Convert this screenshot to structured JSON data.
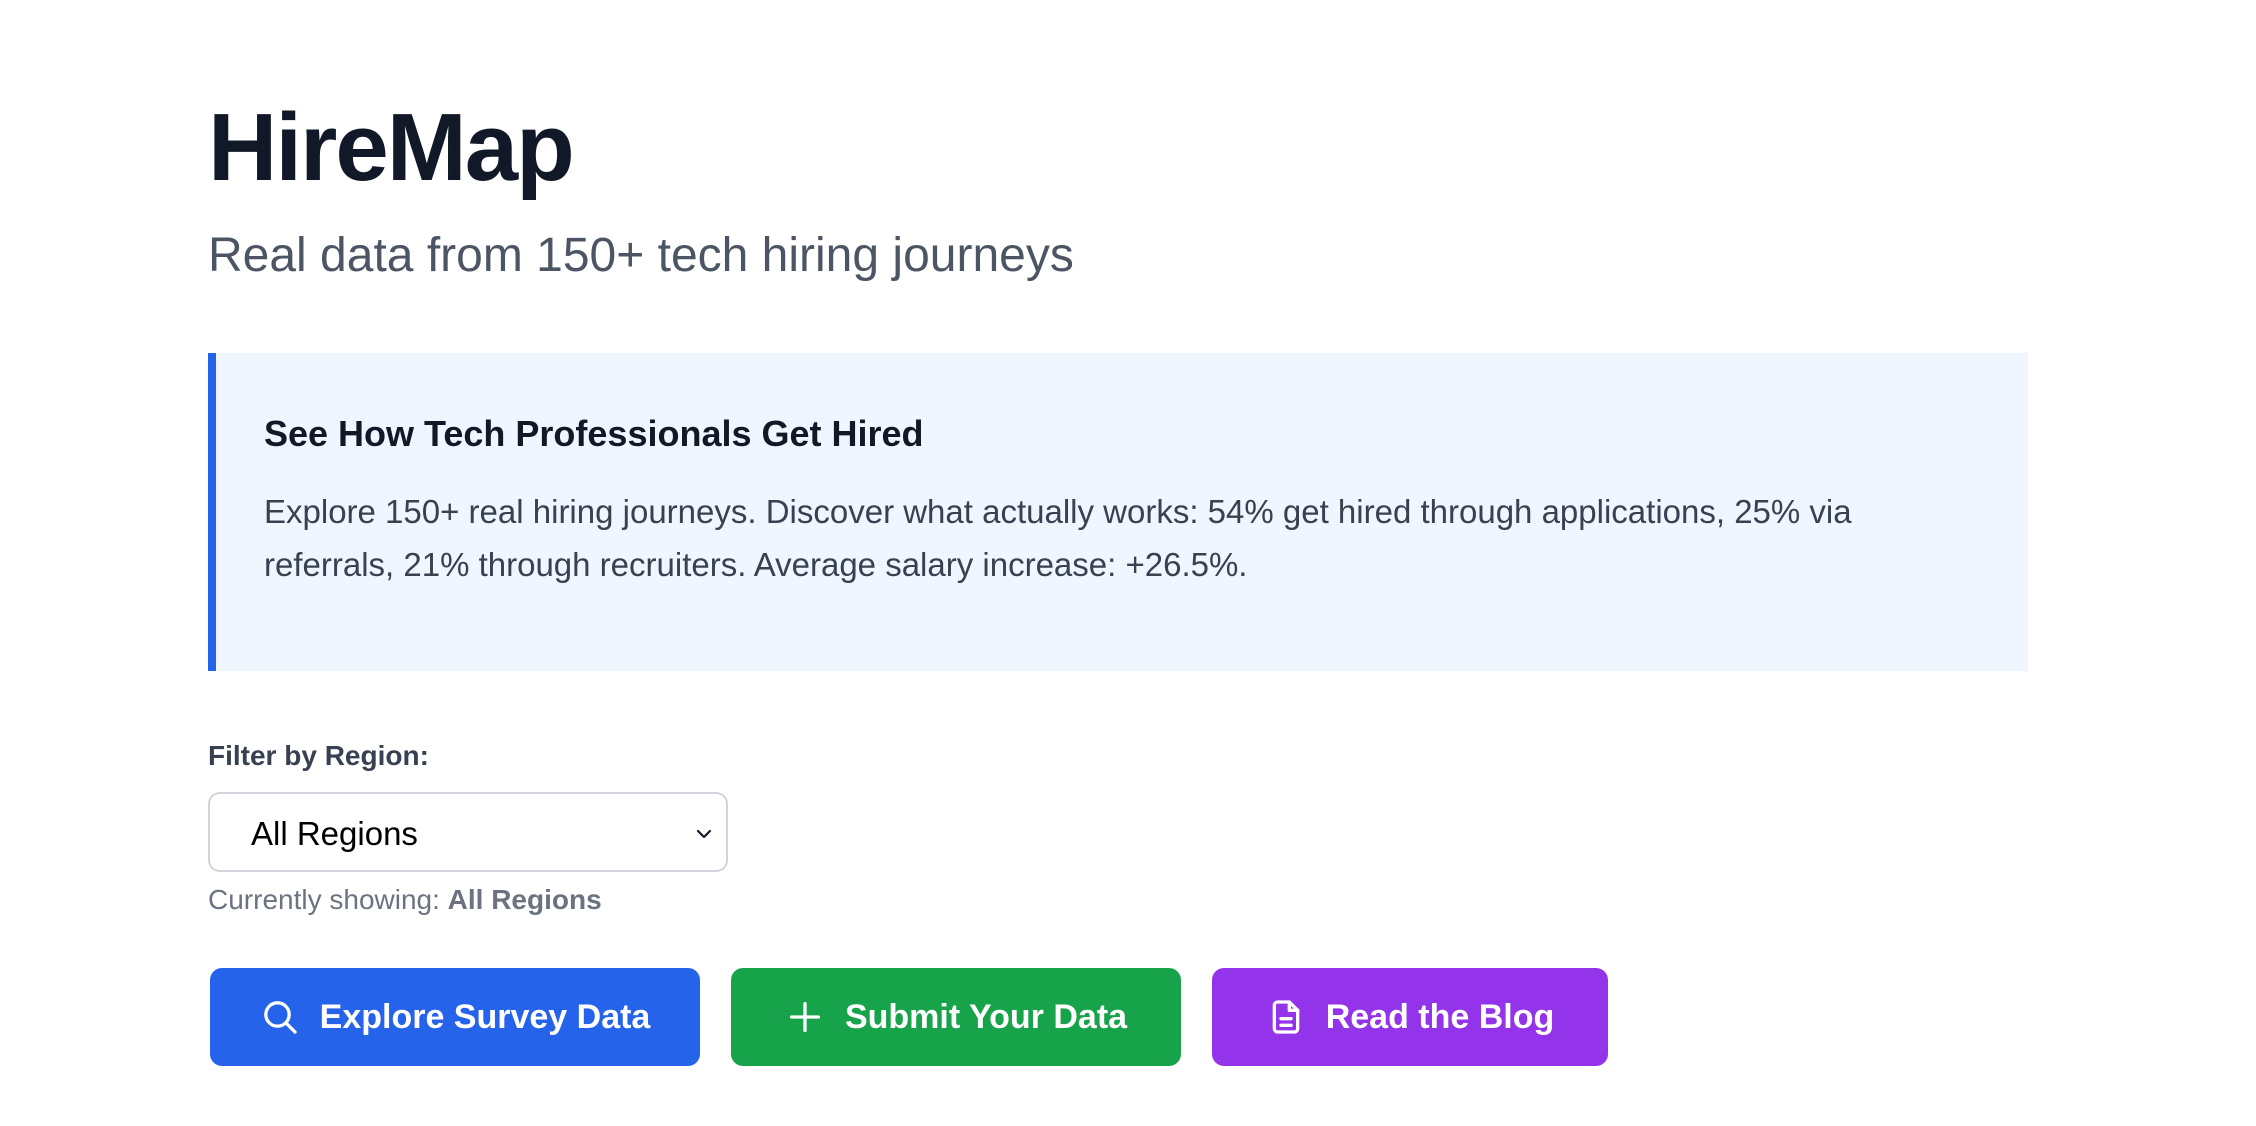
{
  "app": {
    "title": "HireMap",
    "subtitle": "Real data from 150+ tech hiring journeys"
  },
  "callout": {
    "title": "See How Tech Professionals Get Hired",
    "body": "Explore 150+ real hiring journeys. Discover what actually works: 54% get hired through applications, 25% via referrals, 21% through recruiters. Average salary increase: +26.5%.",
    "accent_color": "#2563eb",
    "background_color": "#eff6ff"
  },
  "filter": {
    "label": "Filter by Region:",
    "selected": "All Regions",
    "icon": "chevron-down-icon",
    "showing_prefix": "Currently showing:",
    "showing_value": "All Regions"
  },
  "actions": [
    {
      "label": "Explore Survey Data",
      "icon": "search-icon",
      "color": "#2563eb"
    },
    {
      "label": "Submit Your Data",
      "icon": "plus-icon",
      "color": "#16a34a"
    },
    {
      "label": "Read the Blog",
      "icon": "document-icon",
      "color": "#9333ea"
    }
  ]
}
